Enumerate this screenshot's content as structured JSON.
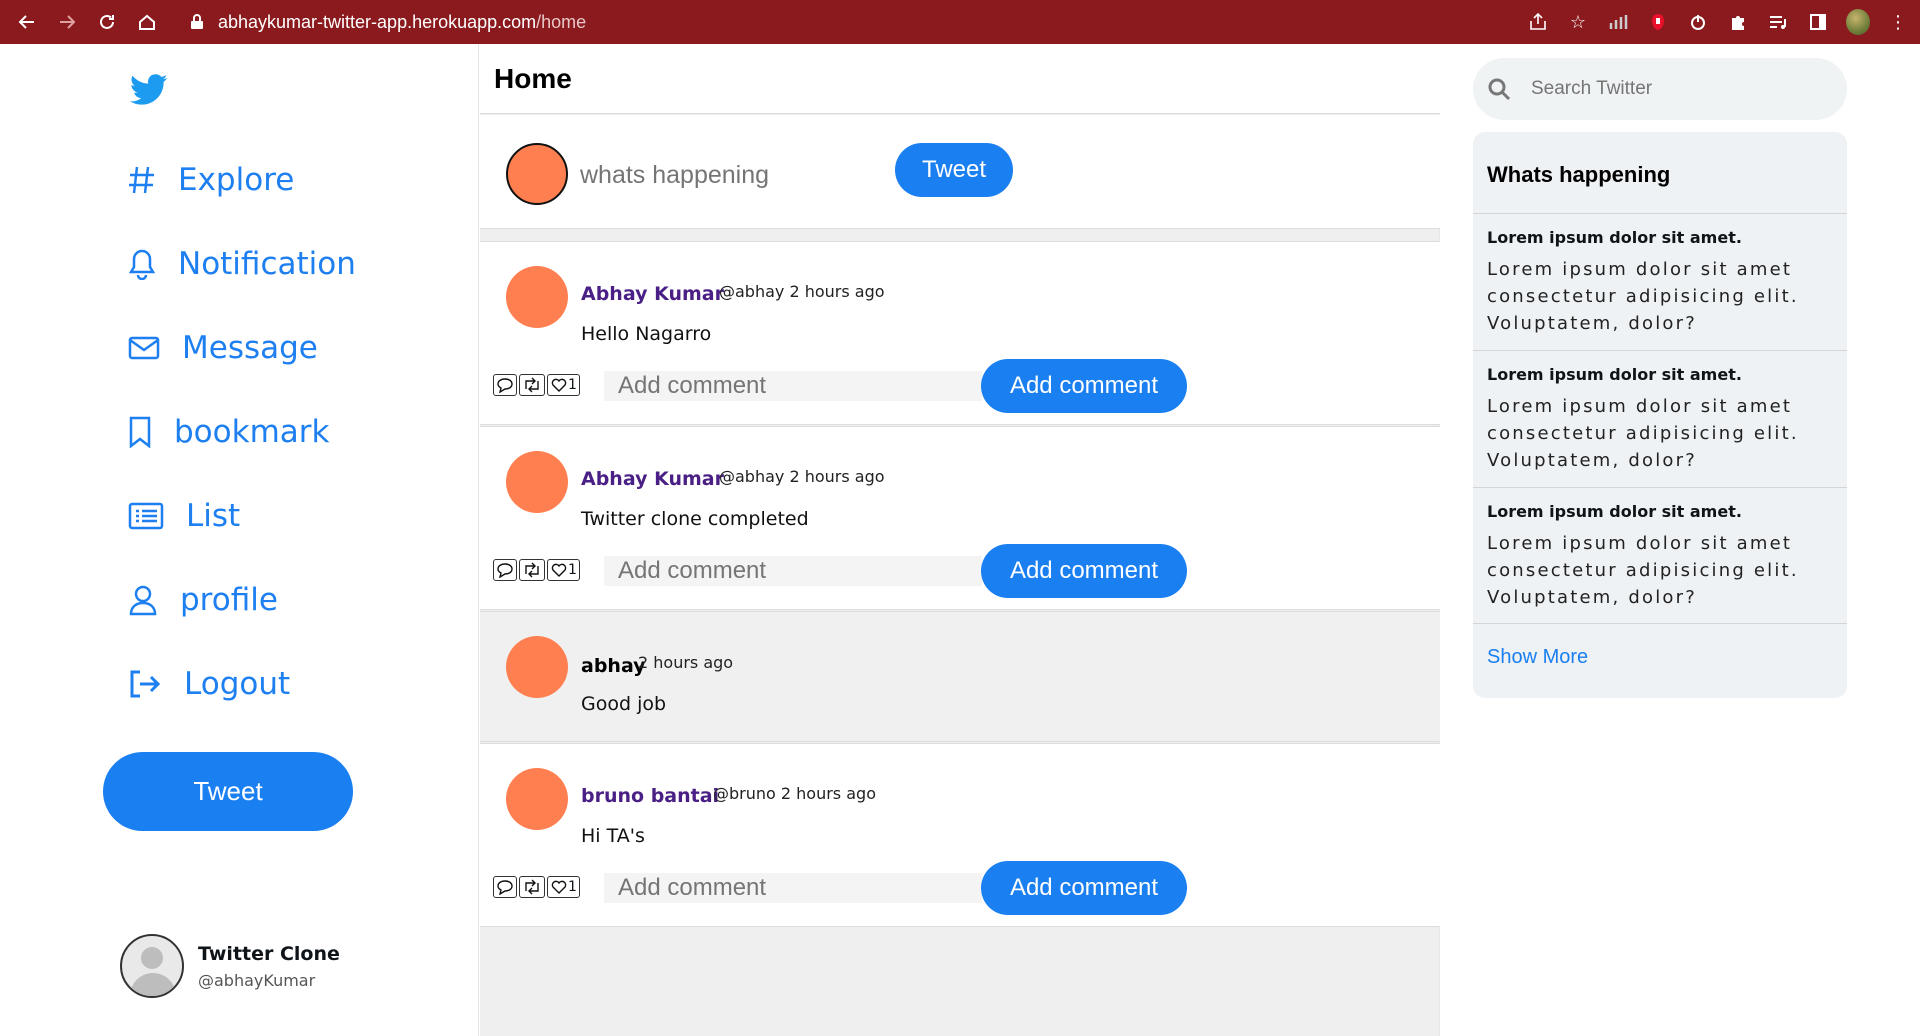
{
  "browser": {
    "url_host": "abhaykumar-twitter-app.herokuapp.com",
    "url_path": "/home"
  },
  "nav": {
    "items": [
      {
        "label": "Explore",
        "icon": "hash-icon"
      },
      {
        "label": "Notification",
        "icon": "bell-icon"
      },
      {
        "label": "Message",
        "icon": "mail-icon"
      },
      {
        "label": "bookmark",
        "icon": "bookmark-icon"
      },
      {
        "label": "List",
        "icon": "list-icon"
      },
      {
        "label": "profile",
        "icon": "user-icon"
      },
      {
        "label": "Logout",
        "icon": "logout-icon"
      }
    ],
    "tweet_label": "Tweet",
    "profile": {
      "name": "Twitter Clone",
      "handle": "@abhayKumar"
    }
  },
  "feed": {
    "title": "Home",
    "composer": {
      "placeholder": "whats happening",
      "button": "Tweet"
    },
    "posts": [
      {
        "name": "Abhay Kumar",
        "meta": "@abhay 2 hours ago",
        "text": "Hello Nagarro",
        "likes": "1",
        "comment_placeholder": "Add comment",
        "comment_button": "Add comment"
      },
      {
        "name": "Abhay Kumar",
        "meta": "@abhay 2 hours ago",
        "text": "Twitter clone completed",
        "likes": "1",
        "comment_placeholder": "Add comment",
        "comment_button": "Add comment"
      },
      {
        "name": "abhay",
        "meta": "2 hours ago",
        "text": "Good job"
      },
      {
        "name": "bruno bantai",
        "meta": "@bruno 2 hours ago",
        "text": "Hi TA's",
        "likes": "1",
        "comment_placeholder": "Add comment",
        "comment_button": "Add comment"
      }
    ]
  },
  "right": {
    "search_placeholder": "Search Twitter",
    "trends_title": "Whats happening",
    "trends": [
      {
        "head": "Lorem ipsum dolor sit amet.",
        "body": "Lorem ipsum dolor sit amet consectetur adipisicing elit. Voluptatem, dolor?"
      },
      {
        "head": "Lorem ipsum dolor sit amet.",
        "body": "Lorem ipsum dolor sit amet consectetur adipisicing elit. Voluptatem, dolor?"
      },
      {
        "head": "Lorem ipsum dolor sit amet.",
        "body": "Lorem ipsum dolor sit amet consectetur adipisicing elit. Voluptatem, dolor?"
      }
    ],
    "show_more": "Show More"
  },
  "colors": {
    "accent": "#1a7ff0",
    "avatar": "#ff7f50",
    "name": "#4a1f86",
    "browser": "#8b1a1f"
  }
}
